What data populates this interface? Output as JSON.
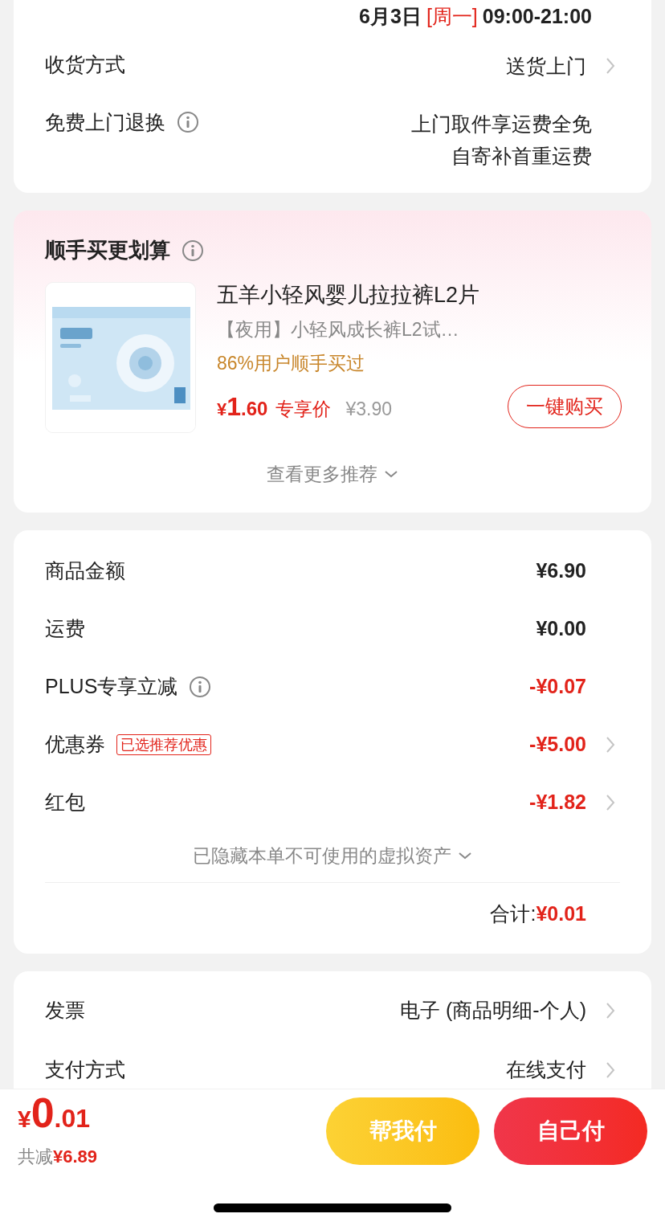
{
  "delivery": {
    "date": "6月3日",
    "weekday": "[周一]",
    "hours": "09:00-21:00"
  },
  "info_rows": [
    {
      "label": "收货方式",
      "value_lines": [
        "送货上门"
      ],
      "info": false,
      "chevron": true
    },
    {
      "label": "免费上门退换",
      "value_lines": [
        "上门取件享运费全免",
        "自寄补首重运费"
      ],
      "info": true,
      "chevron": false
    }
  ],
  "addon": {
    "title": "顺手买更划算",
    "product": {
      "kind": "picture",
      "name": "五羊小轻风婴儿拉拉裤L2片",
      "subtitle": "【夜用】小轻风成长裤L2试…",
      "social_proof": "86%用户顺手买过",
      "price_symbol": "¥",
      "price_int": "1",
      "price_dec": ".60",
      "price_label": "专享价",
      "original_price": "¥3.90",
      "buy_button": "一键购买"
    },
    "more": "查看更多推荐"
  },
  "summary": {
    "rows": [
      {
        "label": "商品金额",
        "value": "¥6.90",
        "kind": "plain",
        "info": false,
        "chevron": false
      },
      {
        "label": "运费",
        "value": "¥0.00",
        "kind": "plain",
        "info": false,
        "chevron": false
      },
      {
        "label": "PLUS专享立减",
        "value": "-¥0.07",
        "kind": "discount",
        "info": true,
        "chevron": false
      },
      {
        "label": "优惠券",
        "tag": "已选推荐优惠",
        "value": "-¥5.00",
        "kind": "discount",
        "info": false,
        "chevron": true
      },
      {
        "label": "红包",
        "value": "-¥1.82",
        "kind": "discount",
        "info": false,
        "chevron": true
      }
    ],
    "hidden_note": "已隐藏本单不可使用的虚拟资产",
    "total_label": "合计:",
    "total_value": "¥0.01"
  },
  "settings": [
    {
      "label": "发票",
      "value": "电子 (商品明细-个人)"
    },
    {
      "label": "支付方式",
      "value": "在线支付"
    }
  ],
  "footer": {
    "symbol": "¥",
    "amount_int": "0",
    "amount_dec": ".01",
    "saved_label": "共减",
    "saved_value": "¥6.89",
    "buttons": [
      {
        "label": "帮我付",
        "kind": "friend"
      },
      {
        "label": "自己付",
        "kind": "self"
      }
    ]
  }
}
